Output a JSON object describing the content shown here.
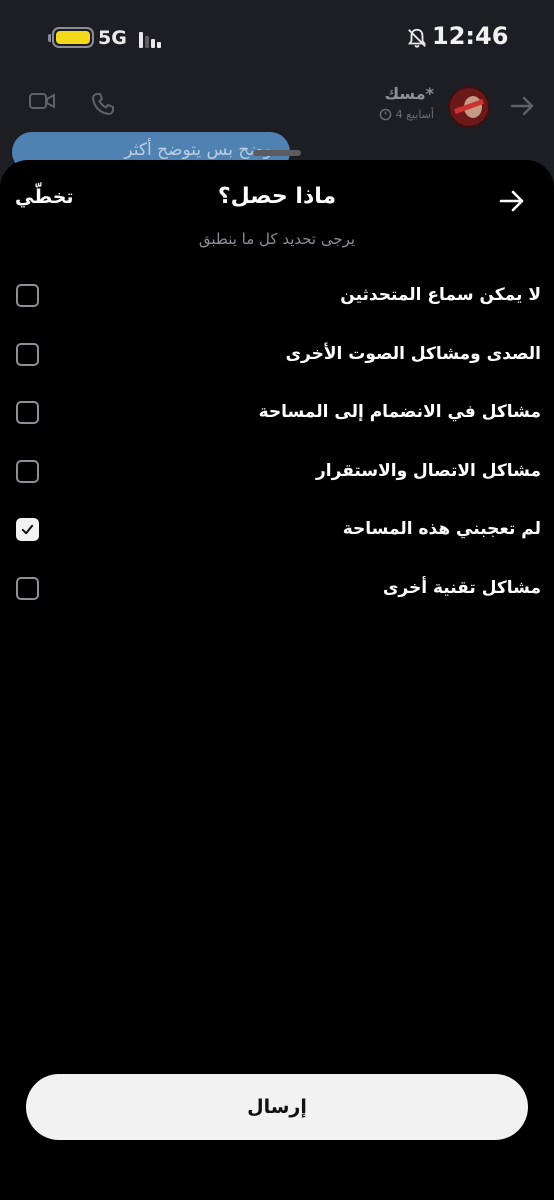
{
  "status_bar": {
    "network": "5G",
    "time": "12:46",
    "battery_color": "#f4d81c"
  },
  "chat_header": {
    "name": "مسك*",
    "time_ago": "4 أسابيع",
    "icons": [
      "back-arrow-icon",
      "video-camera-icon",
      "phone-icon",
      "timer-icon"
    ]
  },
  "background_message": "وضح بس يتوضح أكثر",
  "sheet": {
    "title": "ماذا حصل؟",
    "skip_label": "تخطّي",
    "subtitle": "يرجى تحديد كل ما ينطبق",
    "options": [
      {
        "label": "لا يمكن سماع المتحدثين",
        "checked": false
      },
      {
        "label": "الصدى ومشاكل الصوت الأخرى",
        "checked": false
      },
      {
        "label": "مشاكل في الانضمام إلى المساحة",
        "checked": false
      },
      {
        "label": "مشاكل الاتصال والاستقرار",
        "checked": false
      },
      {
        "label": "لم تعجبني هذه المساحة",
        "checked": true
      },
      {
        "label": "مشاكل تقنية أخرى",
        "checked": false
      }
    ],
    "submit_label": "إرسال"
  },
  "colors": {
    "sheet_bg": "#000000",
    "backdrop": "#1c1e23",
    "button_bg": "#f2f2f3"
  }
}
